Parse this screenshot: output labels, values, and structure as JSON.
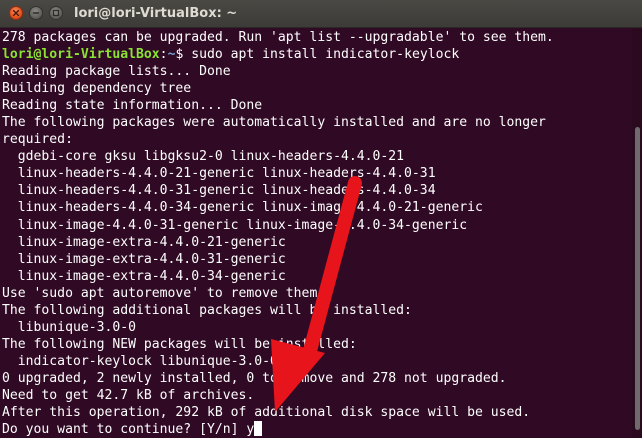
{
  "window": {
    "title": "lori@lori-VirtualBox: ~"
  },
  "terminal": {
    "lines": [
      "278 packages can be upgraded. Run 'apt list --upgradable' to see them.",
      {
        "user": "lori@lori-VirtualBox",
        "sep": ":",
        "path": "~",
        "cmd": "$ sudo apt install indicator-keylock"
      },
      "Reading package lists... Done",
      "Building dependency tree",
      "Reading state information... Done",
      "The following packages were automatically installed and are no longer",
      "required:",
      "  gdebi-core gksu libgksu2-0 linux-headers-4.4.0-21",
      "  linux-headers-4.4.0-21-generic linux-headers-4.4.0-31",
      "  linux-headers-4.4.0-31-generic linux-headers-4.4.0-34",
      "  linux-headers-4.4.0-34-generic linux-image-4.4.0-21-generic",
      "  linux-image-4.4.0-31-generic linux-image-4.4.0-34-generic",
      "  linux-image-extra-4.4.0-21-generic",
      "  linux-image-extra-4.4.0-31-generic",
      "  linux-image-extra-4.4.0-34-generic",
      "Use 'sudo apt autoremove' to remove them.",
      "The following additional packages will be installed:",
      "  libunique-3.0-0",
      "The following NEW packages will be installed:",
      "  indicator-keylock libunique-3.0-0",
      "0 upgraded, 2 newly installed, 0 to remove and 278 not upgraded.",
      "Need to get 42.7 kB of archives.",
      "After this operation, 292 kB of additional disk space will be used.",
      {
        "prompt": "Do you want to continue? [Y/n] ",
        "input": "y"
      }
    ]
  },
  "colors": {
    "background": "#300a24",
    "text": "#ffffff",
    "prompt_user": "#8ae234",
    "prompt_path": "#729fcf",
    "annotation_arrow": "#e8141b"
  },
  "scrollbar": {
    "position": 0.92,
    "visible_fraction": 0.74
  }
}
